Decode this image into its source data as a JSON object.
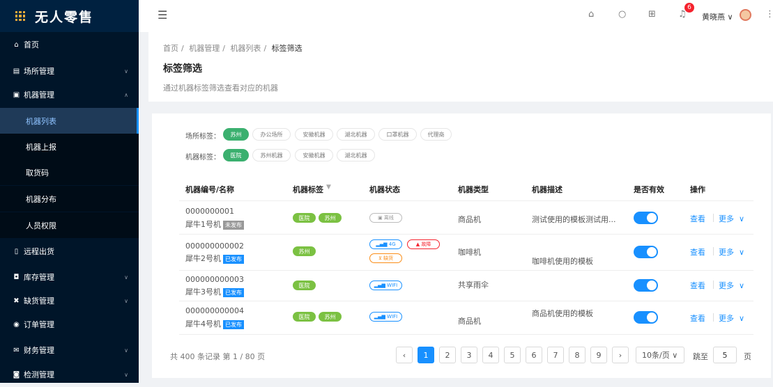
{
  "app": {
    "title": "无人零售"
  },
  "sidebar": {
    "menu": [
      {
        "label": "首页",
        "icon": "home-icon",
        "glyph": "⌂"
      },
      {
        "label": "场所管理",
        "icon": "store-icon",
        "glyph": "▤"
      },
      {
        "label": "机器管理",
        "icon": "machine-icon",
        "glyph": "▣"
      },
      {
        "label": "远程出货",
        "icon": "remote-icon",
        "glyph": "▯"
      },
      {
        "label": "库存管理",
        "icon": "inventory-icon",
        "glyph": "◘"
      },
      {
        "label": "缺货管理",
        "icon": "shortage-icon",
        "glyph": "✖"
      },
      {
        "label": "订单管理",
        "icon": "order-icon",
        "glyph": "◉"
      },
      {
        "label": "财务管理",
        "icon": "finance-icon",
        "glyph": "✉"
      },
      {
        "label": "检测管理",
        "icon": "monitor-icon",
        "glyph": "◙"
      }
    ],
    "submenu": [
      {
        "label": "机器列表"
      },
      {
        "label": "机器上报"
      },
      {
        "label": "取货码"
      },
      {
        "label": "机器分布"
      },
      {
        "label": "人员权限"
      }
    ]
  },
  "topbar": {
    "notification_count": "6",
    "user_name": "黄晓燕"
  },
  "breadcrumb": [
    "首页",
    "机器管理",
    "机器列表",
    "标签筛选"
  ],
  "page": {
    "title": "标签筛选",
    "description": "通过机器标签筛选查看对应的机器"
  },
  "filters": {
    "place_label": "场所标签：",
    "place_tags": [
      "苏州",
      "办公场所",
      "安徽机器",
      "湖北机器",
      "口罩机器",
      "代理商"
    ],
    "machine_label": "机器标签：",
    "machine_tags": [
      "医院",
      "苏州机器",
      "安徽机器",
      "湖北机器"
    ]
  },
  "table": {
    "headers": [
      "机器编号/名称",
      "机器标签",
      "机器状态",
      "机器类型",
      "机器描述",
      "是否有效",
      "操作"
    ],
    "rows": [
      {
        "id": "0000000001",
        "name": "犀牛1号机",
        "publish": "未发布",
        "tags": [
          "医院",
          "苏州"
        ],
        "states": [
          "离线"
        ],
        "type": "商品机",
        "desc": "测试使用的模板测试用...",
        "view": "查看",
        "more": "更多"
      },
      {
        "id": "000000000002",
        "name": "犀牛2号机",
        "publish": "已发布",
        "tags": [
          "苏州"
        ],
        "states": [
          "4G",
          "故障",
          "缺货"
        ],
        "type": "咖啡机",
        "desc": "咖啡机使用的模板",
        "view": "查看",
        "more": "更多"
      },
      {
        "id": "000000000003",
        "name": "犀牛3号机",
        "publish": "已发布",
        "tags": [
          "医院"
        ],
        "states": [
          "WIFI"
        ],
        "type": "共享雨伞",
        "desc": "",
        "view": "查看",
        "more": "更多"
      },
      {
        "id": "000000000004",
        "name": "犀牛4号机",
        "publish": "已发布",
        "tags": [
          "医院",
          "苏州"
        ],
        "states": [
          "WIFI"
        ],
        "type": "商品机",
        "desc": "商品机使用的模板",
        "view": "查看",
        "more": "更多"
      }
    ]
  },
  "pagination": {
    "total_text": "共 400 条记录 第 1 / 80 页",
    "pages": [
      "1",
      "2",
      "3",
      "4",
      "5",
      "6",
      "7",
      "8",
      "9"
    ],
    "page_size": "10条/页",
    "jump_label": "跳至",
    "jump_value": "5",
    "page_unit": "页"
  }
}
